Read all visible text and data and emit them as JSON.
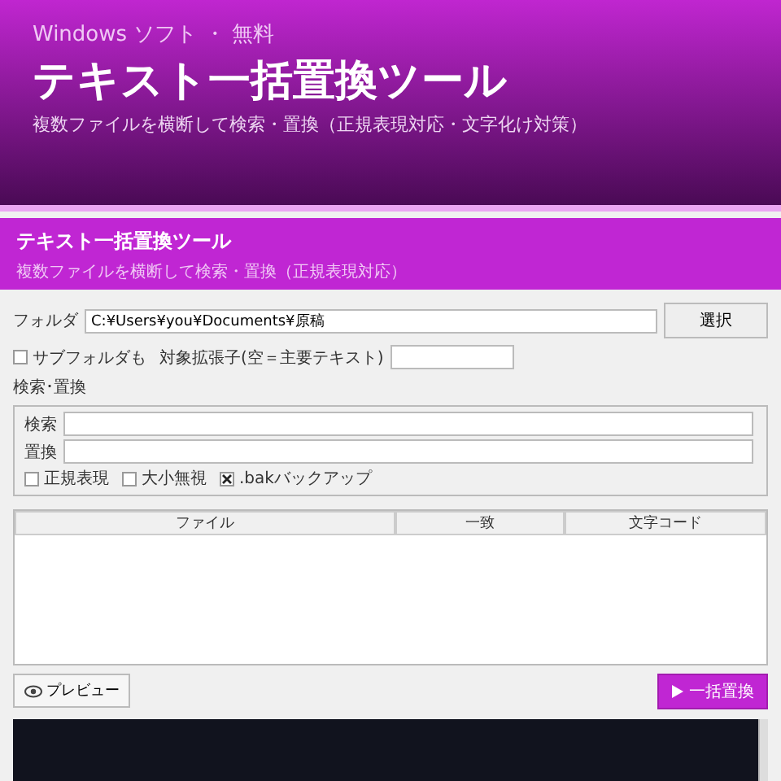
{
  "banner": {
    "eyebrow": "Windows ソフト ・ 無料",
    "title": "テキスト一括置換ツール",
    "subtitle": "複数ファイルを横断して検索・置換（正規表現対応・文字化け対策）"
  },
  "app": {
    "title": "テキスト一括置換ツール",
    "subtitle": "複数ファイルを横断して検索・置換（正規表現対応）"
  },
  "folder": {
    "label": "フォルダ",
    "value": "C:¥Users¥you¥Documents¥原稿",
    "button": "選択"
  },
  "subfolders": {
    "label": "サブフォルダも",
    "checked": false
  },
  "extensions": {
    "label": "対象拡張子(空＝主要テキスト)"
  },
  "group": {
    "title": "検索･置換",
    "fields": [
      {
        "label": "検索"
      },
      {
        "label": "置換"
      }
    ],
    "options": [
      {
        "label": "正規表現",
        "checked": false
      },
      {
        "label": "大小無視",
        "checked": false
      },
      {
        "label": ".bakバックアップ",
        "checked": true
      }
    ]
  },
  "table": {
    "columns": [
      "ファイル",
      "一致",
      "文字コード"
    ]
  },
  "preview_button": "プレビュー",
  "replace_button": "一括置換"
}
